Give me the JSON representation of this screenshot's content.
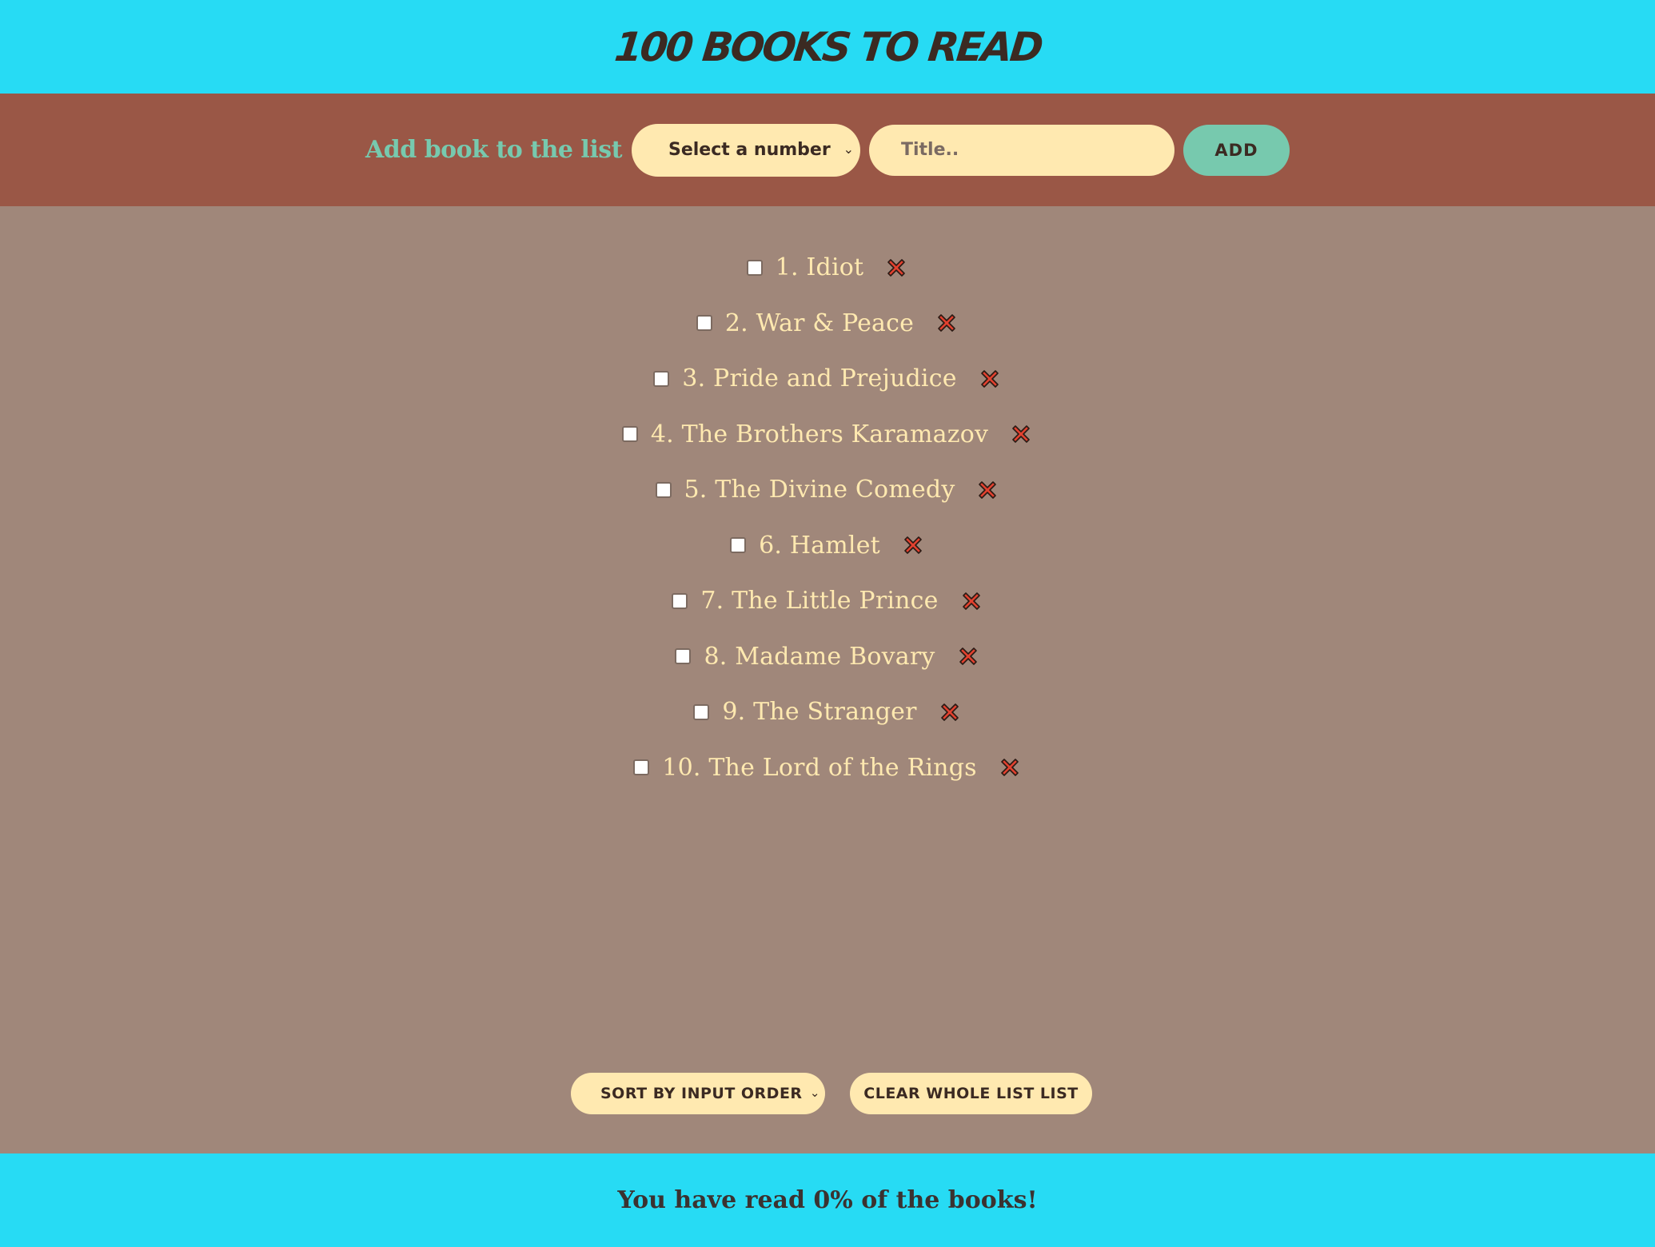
{
  "header": {
    "title": "100 BOOKS TO READ"
  },
  "add_bar": {
    "label": "Add book to the list",
    "number_select": "Select a number",
    "title_placeholder": "Title..",
    "add_button": "ADD"
  },
  "books": [
    {
      "text": "1. Idiot",
      "read": false
    },
    {
      "text": "2. War & Peace",
      "read": false
    },
    {
      "text": "3. Pride and Prejudice",
      "read": false
    },
    {
      "text": "4. The Brothers Karamazov",
      "read": false
    },
    {
      "text": "5. The Divine Comedy",
      "read": false
    },
    {
      "text": "6. Hamlet",
      "read": false
    },
    {
      "text": "7. The Little Prince",
      "read": false
    },
    {
      "text": "8. Madame Bovary",
      "read": false
    },
    {
      "text": "9. The Stranger",
      "read": false
    },
    {
      "text": "10. The Lord of the Rings",
      "read": false
    }
  ],
  "controls": {
    "sort_select": "SORT BY INPUT ORDER",
    "clear_button": "CLEAR WHOLE LIST LIST"
  },
  "footer": {
    "progress_text": "You have read 0% of the books!"
  },
  "colors": {
    "header_bg": "#27DBF4",
    "add_bar_bg": "#9A5746",
    "main_bg": "#A0877A",
    "accent_green": "#77C9AE",
    "cream": "#FFE9B0",
    "delete_red": "#E2412F"
  },
  "icons": {
    "delete": "close-x-icon",
    "dropdown": "chevron-down-icon"
  }
}
